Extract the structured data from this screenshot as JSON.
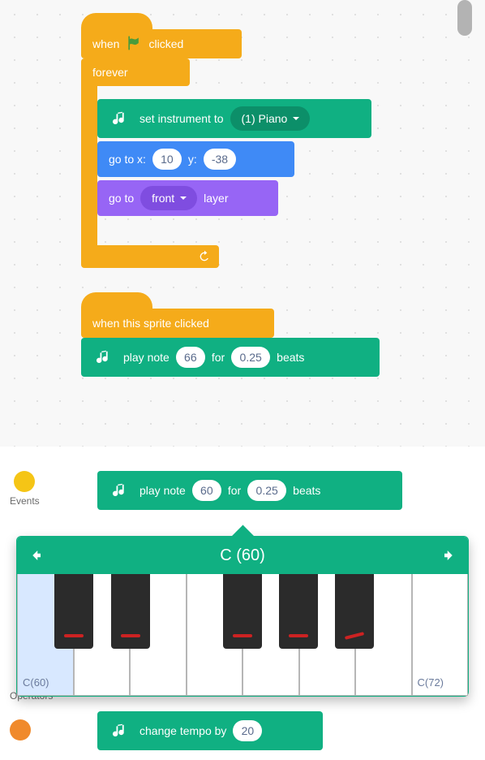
{
  "top": {
    "when_flag": {
      "prefix": "when",
      "suffix": "clicked"
    },
    "forever_label": "forever",
    "set_instrument": {
      "label": "set instrument to",
      "value": "(1) Piano"
    },
    "goto_xy": {
      "pre": "go to x:",
      "x": "10",
      "mid": "y:",
      "y": "-38"
    },
    "goto_layer": {
      "pre": "go to",
      "value": "front",
      "post": "layer"
    },
    "when_sprite": "when this sprite clicked",
    "play1": {
      "pre": "play note",
      "note": "66",
      "mid": "for",
      "beats": "0.25",
      "post": "beats"
    }
  },
  "categories": {
    "events": {
      "label": "Events",
      "color": "#f5c516"
    },
    "operators": {
      "label": "Operators",
      "color": "#5bbb57"
    },
    "third_color": "#f08a2c"
  },
  "bottom": {
    "play2": {
      "pre": "play note",
      "note": "60",
      "mid": "for",
      "beats": "0.25",
      "post": "beats"
    },
    "tempo": {
      "pre": "change tempo by",
      "value": "20"
    },
    "popup": {
      "title": "C (60)",
      "low": "C(60)",
      "high": "C(72)"
    }
  }
}
